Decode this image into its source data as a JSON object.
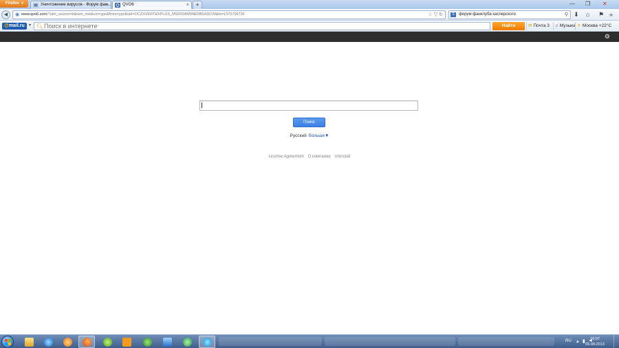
{
  "browser": {
    "menu_label": "Firefox",
    "tabs": [
      {
        "title": "Уничтожение вирусов - Форум фан...",
        "active": false
      },
      {
        "title": "QVO6",
        "active": true
      }
    ],
    "url_host": "www.qvo6.com",
    "url_rest": "/?utm_source=b&utm_medium=ypc&from=ypc&uid=OCZXVERTEXPLUS_MS6954W04829554301M&ts=1375706736",
    "search_value": "форум фанклуба касперского"
  },
  "mailru": {
    "logo_prefix": "@",
    "logo_text": "mail.ru",
    "search_placeholder": "Поиск в интернете",
    "find_label": "Найти",
    "mail_label": "Почта 3",
    "music_label": "Музыка",
    "weather_label": "Москва +22°C"
  },
  "page": {
    "search_button": "Поиск",
    "language": "Русский",
    "more_link": "больше▼",
    "footer": [
      "License Agreement",
      "О компании",
      "Uninstall"
    ]
  },
  "taskbar": {
    "lang": "RU",
    "time": "16:07",
    "date": "05.08.2013"
  },
  "colors": {
    "accent_orange": "#f07d00",
    "search_blue": "#3c7fe6",
    "dark_header": "#2d2d2d"
  }
}
